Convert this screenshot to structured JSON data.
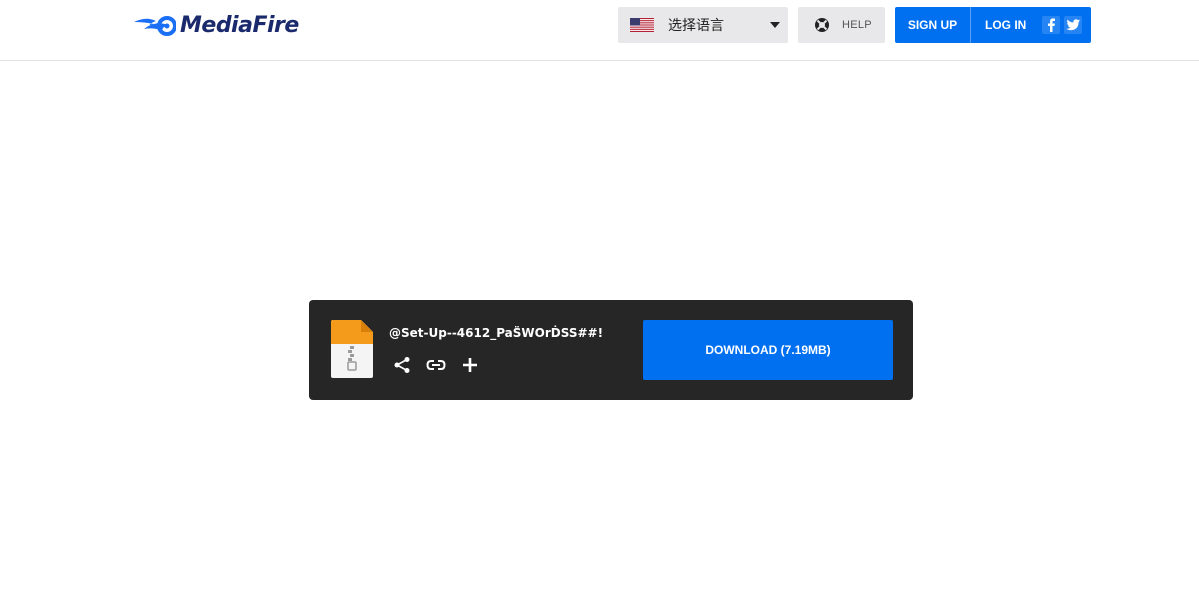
{
  "header": {
    "logo_text": "MediaFire",
    "language_select": {
      "selected": "选择语言",
      "flag": "us-flag-icon"
    },
    "help_label": "HELP",
    "signup_label": "SIGN UP",
    "login_label": "LOG IN",
    "social": [
      "facebook-icon",
      "twitter-icon"
    ]
  },
  "file": {
    "name": "@Set-Up--4612_PaS̈WOrḊSS##!",
    "icon": "zip-file-icon",
    "actions": [
      "share-icon",
      "link-icon",
      "plus-icon"
    ],
    "download_label": "DOWNLOAD (7.19MB)"
  },
  "colors": {
    "brand_blue": "#0070f0",
    "card_bg": "#262626",
    "logo_navy": "#1a2a6c"
  }
}
